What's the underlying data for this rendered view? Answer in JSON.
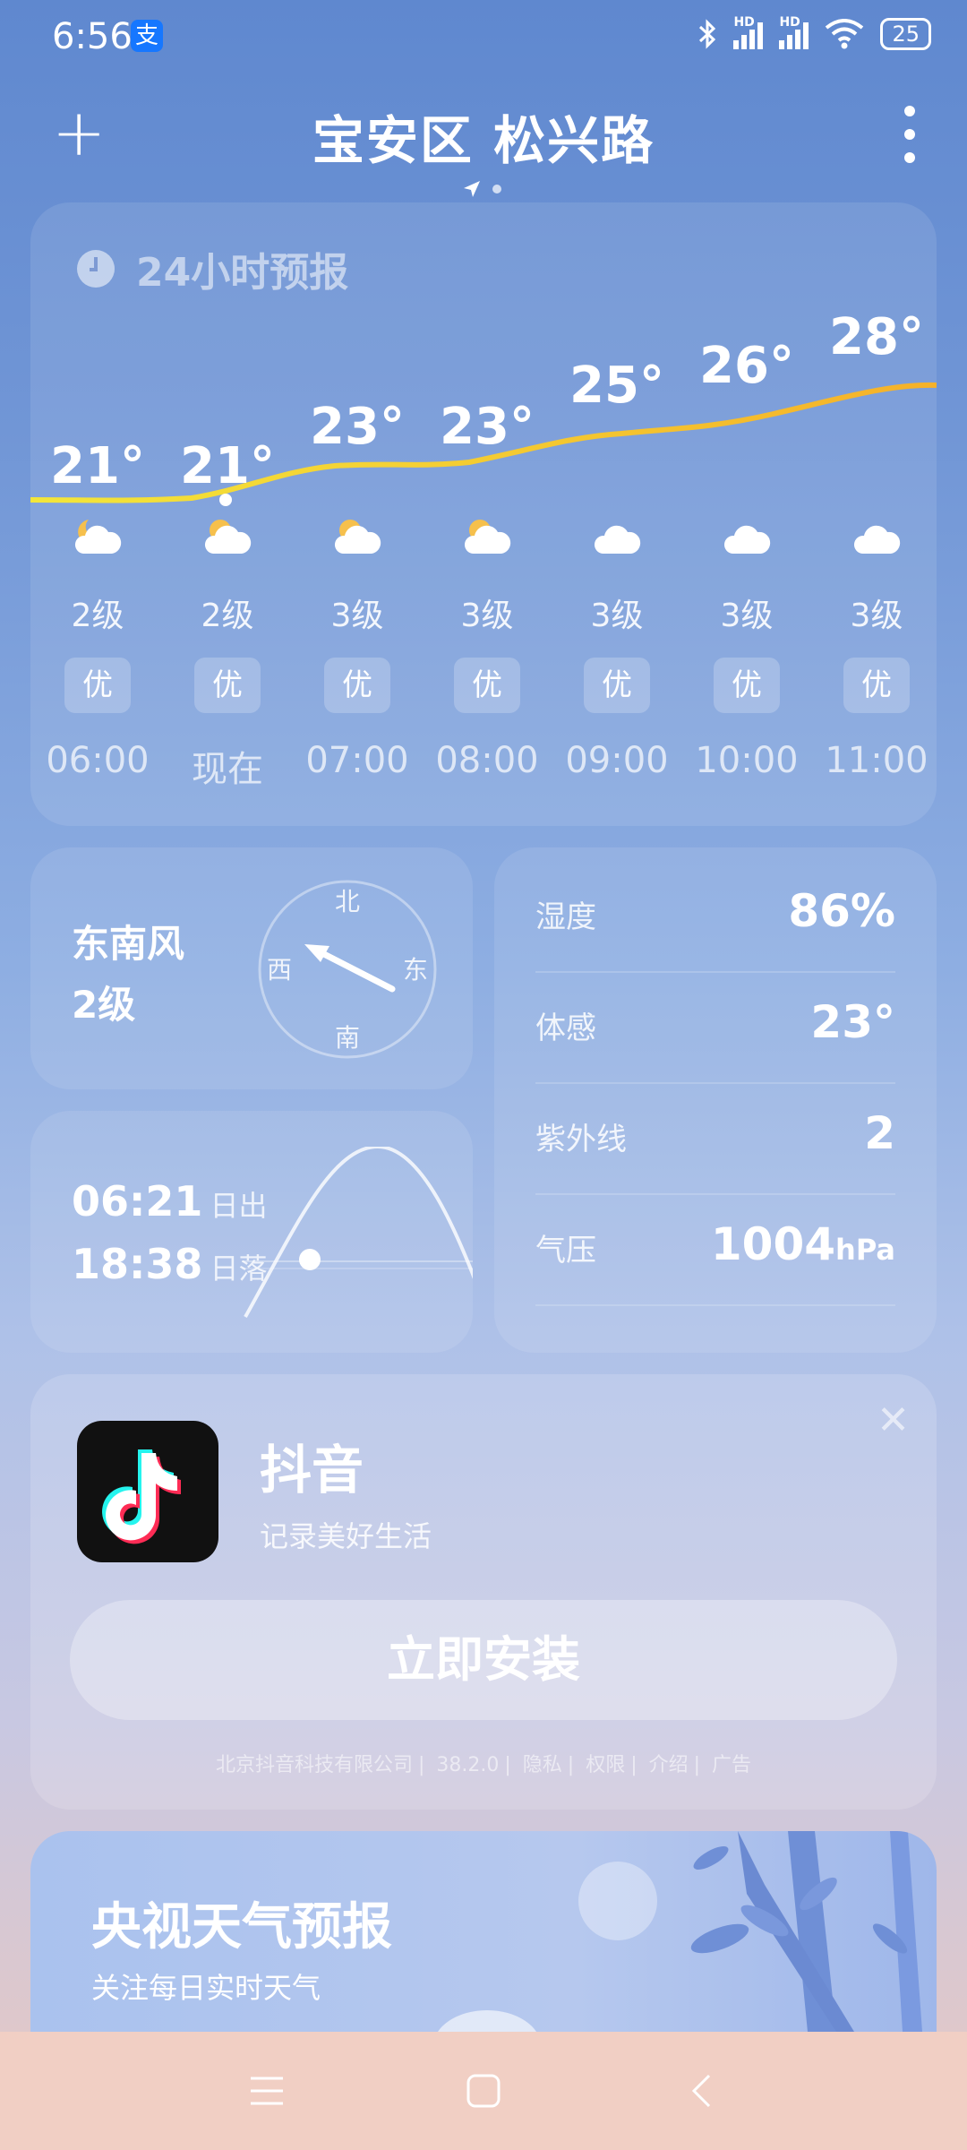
{
  "status_bar": {
    "time": "6:56",
    "alipay_badge": "支",
    "net1": "HD",
    "net2": "HD",
    "battery": "25"
  },
  "header": {
    "add_icon": "plus-icon",
    "title": "宝安区 松兴路",
    "more_icon": "more-vertical-icon"
  },
  "forecast": {
    "title": "24小时预报",
    "hours": [
      {
        "temp": "21°",
        "icon": "partly-cloudy-night",
        "wind": "2级",
        "aqi": "优",
        "time": "06:00"
      },
      {
        "temp": "21°",
        "icon": "partly-cloudy-day",
        "wind": "2级",
        "aqi": "优",
        "time": "现在"
      },
      {
        "temp": "23°",
        "icon": "partly-cloudy-day",
        "wind": "3级",
        "aqi": "优",
        "time": "07:00"
      },
      {
        "temp": "23°",
        "icon": "partly-cloudy-day",
        "wind": "3级",
        "aqi": "优",
        "time": "08:00"
      },
      {
        "temp": "25°",
        "icon": "cloudy",
        "wind": "3级",
        "aqi": "优",
        "time": "09:00"
      },
      {
        "temp": "26°",
        "icon": "cloudy",
        "wind": "3级",
        "aqi": "优",
        "time": "10:00"
      },
      {
        "temp": "28°",
        "icon": "cloudy",
        "wind": "3级",
        "aqi": "优",
        "time": "11:00"
      }
    ]
  },
  "wind": {
    "direction": "东南风",
    "level": "2级",
    "compass": {
      "n": "北",
      "s": "南",
      "w": "西",
      "e": "东"
    }
  },
  "sun": {
    "sunrise_time": "06:21",
    "sunrise_label": "日出",
    "sunset_time": "18:38",
    "sunset_label": "日落"
  },
  "details": {
    "humidity_label": "湿度",
    "humidity": "86%",
    "feels_label": "体感",
    "feels": "23°",
    "uv_label": "紫外线",
    "uv": "2",
    "pressure_label": "气压",
    "pressure": "1004",
    "pressure_unit": "hPa"
  },
  "ad": {
    "app_name": "抖音",
    "tagline": "记录美好生活",
    "install_label": "立即安装",
    "footer": [
      "北京抖音科技有限公司",
      "38.2.0",
      "隐私",
      "权限",
      "介绍",
      "广告"
    ]
  },
  "cctv": {
    "title": "央视天气预报",
    "subtitle": "关注每日实时天气"
  },
  "colors": {
    "temp_curve_start": "#f3e63a",
    "temp_curve_end": "#f5b12a",
    "alipay_blue": "#1677ff"
  }
}
